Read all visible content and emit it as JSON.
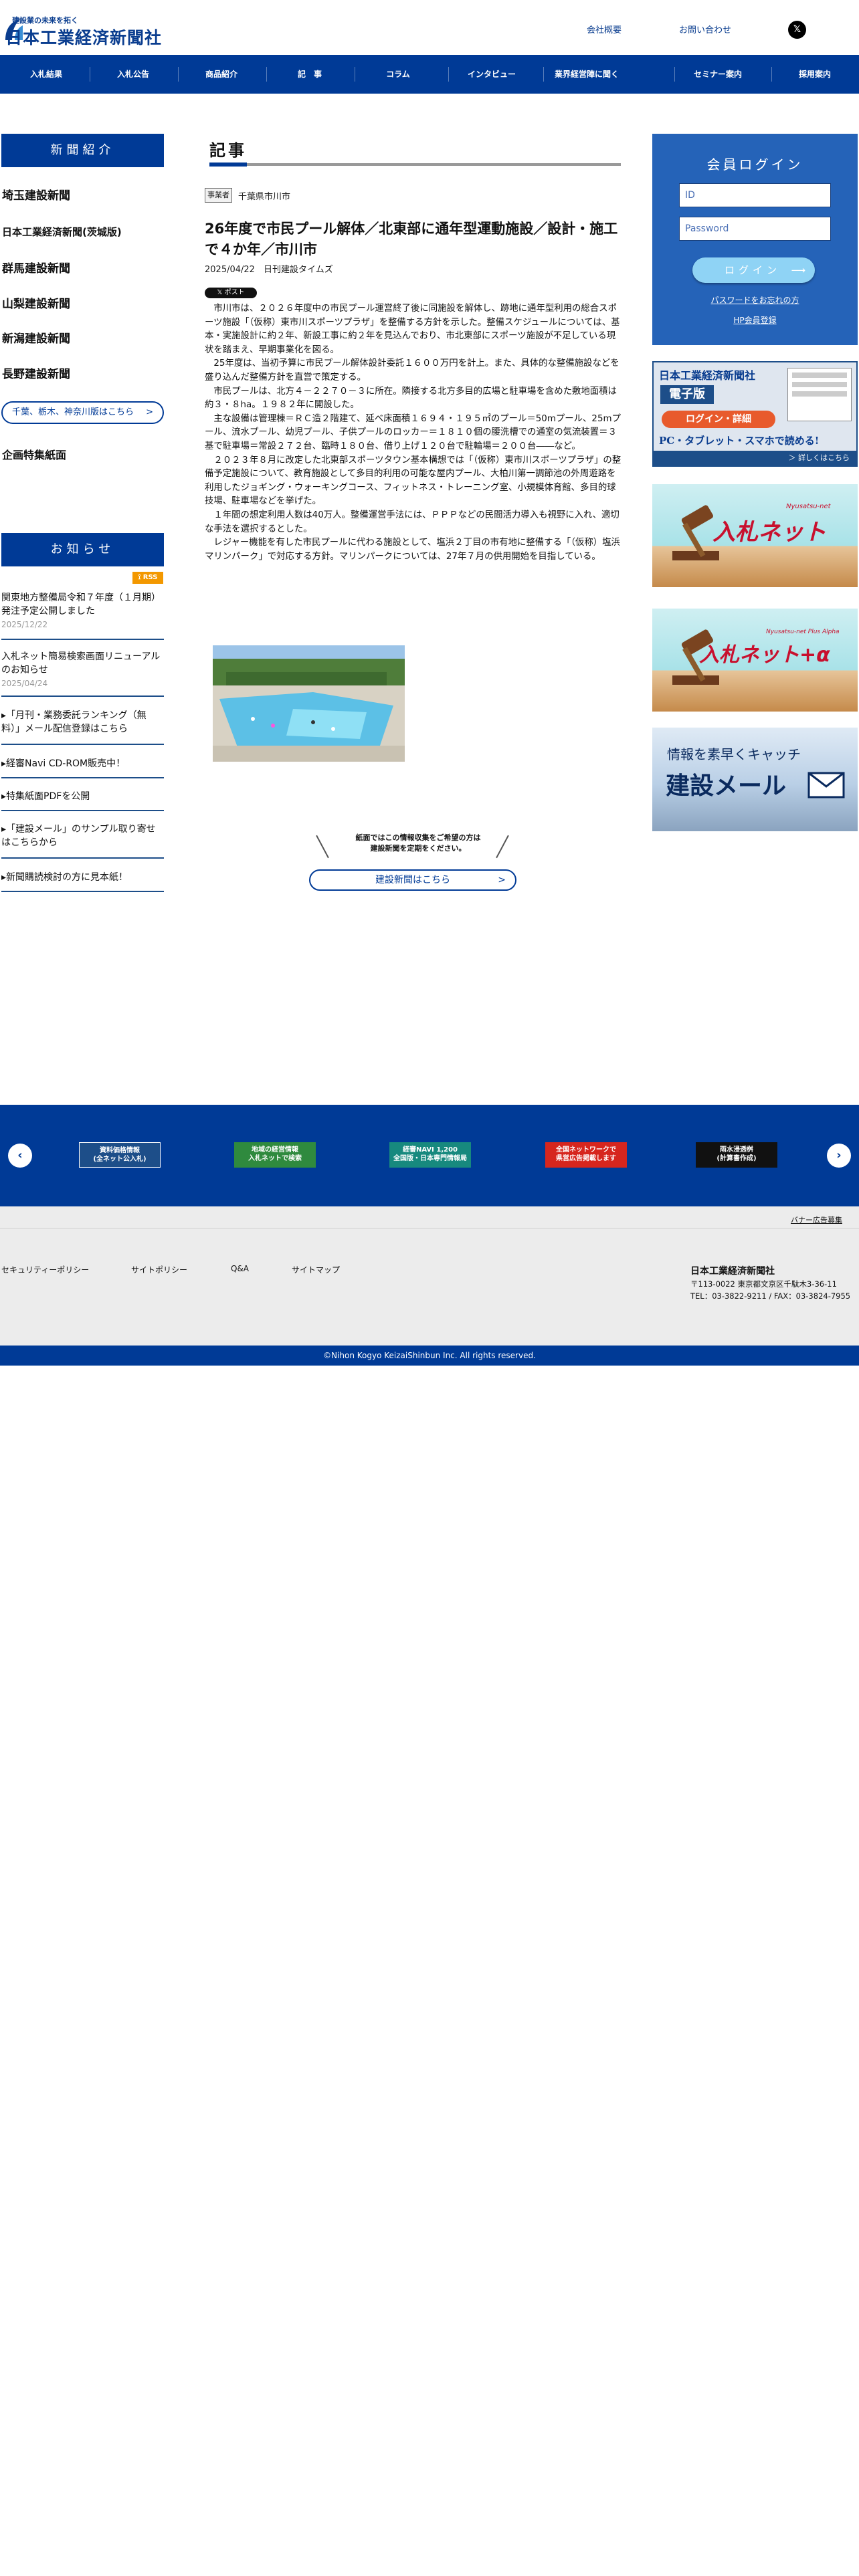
{
  "header": {
    "logo_tagline": "建設業の未来を拓く",
    "logo_name": "日本工業経済新聞社",
    "links": [
      "会社概要",
      "お問い合わせ"
    ],
    "x_icon": "x-logo-icon"
  },
  "nav": [
    "入札結果",
    "入札公告",
    "商品紹介",
    "記　事",
    "コラム",
    "インタビュー",
    "業界経営陣に聞く",
    "セミナー案内",
    "採用案内"
  ],
  "sidebar": {
    "newspapers_heading": "新聞紹介",
    "newspapers": [
      "埼玉建設新聞",
      "日本工業経済新聞(茨城版)",
      "群馬建設新聞",
      "山梨建設新聞",
      "新潟建設新聞",
      "長野建設新聞"
    ],
    "more_regions": "千葉、栃木、神奈川版はこちら",
    "special_pages": "企画特集紙面",
    "notices_heading": "お知らせ",
    "rss": "RSS",
    "notices": [
      {
        "text": "関東地方整備局令和７年度（１月期）発注予定公開しました",
        "date": "2025/12/22"
      },
      {
        "text": "入札ネット簡易検索画面リニューアルのお知らせ",
        "date": "2025/04/24"
      },
      {
        "text": "「月刊・業務委託ランキング（無料）」メール配信登録はこちら",
        "date": ""
      },
      {
        "text": "経審Navi CD-ROM販売中！",
        "date": ""
      },
      {
        "text": "特集紙面PDFを公開",
        "date": ""
      },
      {
        "text": "「建設メール」のサンプル取り寄せはこちらから",
        "date": ""
      },
      {
        "text": "新聞購読検討の方に見本紙！",
        "date": ""
      }
    ]
  },
  "article": {
    "section_heading": "記事",
    "badge": "事業者",
    "location": "千葉県市川市",
    "title": "26年度で市民プール解体／北東部に通年型運動施設／設計・施工で４か年／市川市",
    "date": "2025/04/22",
    "source": "日刊建設タイムズ",
    "x_post": "ポスト",
    "paragraphs": [
      "市川市は、２０２６年度中の市民プール運営終了後に同施設を解体し、跡地に通年型利用の総合スポーツ施設「（仮称）東市川スポーツプラザ」を整備する方針を示した。整備スケジュールについては、基本・実施設計に約２年、新設工事に約２年を見込んでおり、市北東部にスポーツ施設が不足している現状を踏まえ、早期事業化を図る。",
      "25年度は、当初予算に市民プール解体設計委託１６００万円を計上。また、具体的な整備施設などを盛り込んだ整備方針を直営で策定する。",
      "市民プールは、北方４－２２７０－３に所在。隣接する北方多目的広場と駐車場を含めた敷地面積は約３・８ha。１９８２年に開設した。",
      "主な設備は管理棟＝ＲＣ造２階建て、延べ床面積１６９４・１９５㎡のプール＝50mプール、25mプール、流水プール、幼児プール、子供プールのロッカー＝１８１０個の腰洗槽での通室の気流装置＝３基で駐車場＝常設２７２台、臨時１８０台、借り上げ１２０台で駐輪場＝２００台――など。",
      "２０２３年８月に改定した北東部スポーツタウン基本構想では「（仮称）東市川スポーツプラザ」の整備予定施設について、教育施設として多目的利用の可能な屋内プール、大柏川第一調節池の外周遊路を利用したジョギング・ウォーキングコース、フィットネス・トレーニング室、小規模体育館、多目的球技場、駐車場などを挙げた。",
      "１年間の想定利用人数は40万人。整備運営手法には、ＰＰＰなどの民間活力導入も視野に入れ、適切な手法を選択するとした。",
      "レジャー機能を有した市民プールに代わる施設として、塩浜２丁目の市有地に整備する「（仮称）塩浜マリンパーク」で対応する方針。マリンパークについては、27年７月の供用開始を目指している。"
    ],
    "info_text": "紙面ではこの情報収集をご希望の方は\n建設新聞を定期をください。",
    "kensetsu_button": "建設新聞はこちら"
  },
  "login": {
    "title": "会員ログイン",
    "id_placeholder": "ID",
    "password_placeholder": "Password",
    "button": "ログイン",
    "forgot": "パスワードをお忘れの方",
    "register": "HP会員登録"
  },
  "banners": {
    "denshiban": {
      "company": "日本工業経済新聞社",
      "label": "電子版",
      "login": "ログイン・詳細",
      "devices": "PC・タブレット・スマホで読める!",
      "more": "＞ 詳しくはこちら"
    },
    "nyusatsu": {
      "kana": "Nyusatsu-net",
      "text": "入札ネット"
    },
    "nyusatsu_plus": {
      "kana": "Nyusatsu-net Plus Alpha",
      "text": "入札ネット+α"
    },
    "kensetsu_mail": {
      "line1": "情報を素早くキャッチ",
      "line2": "建設メール"
    }
  },
  "strip_banners": [
    {
      "line1": "資料価格情報",
      "line2": "(全ネット公入札)"
    },
    {
      "line1": "地域の経営情報",
      "line2": "入札ネットで検索"
    },
    {
      "line1": "経審NAVI 1,200",
      "line2": "全国版・日本専門情報局"
    },
    {
      "line1": "全国ネットワークで",
      "line2": "県営広告掲載します"
    },
    {
      "line1": "雨水浸透桝",
      "line2": "(計算書作成)"
    }
  ],
  "footer": {
    "banner_recruit": "バナー広告募集",
    "links": [
      "セキュリティーポリシー",
      "サイトポリシー",
      "Q&A",
      "サイトマップ"
    ],
    "company": "日本工業経済新聞社",
    "address": "〒113-0022 東京都文京区千駄木3-36-11",
    "tel": "TEL：03-3822-9211 / FAX：03-3824-7955",
    "copyright": "©Nihon Kogyo KeizaiShinbun Inc. All rights reserved."
  }
}
